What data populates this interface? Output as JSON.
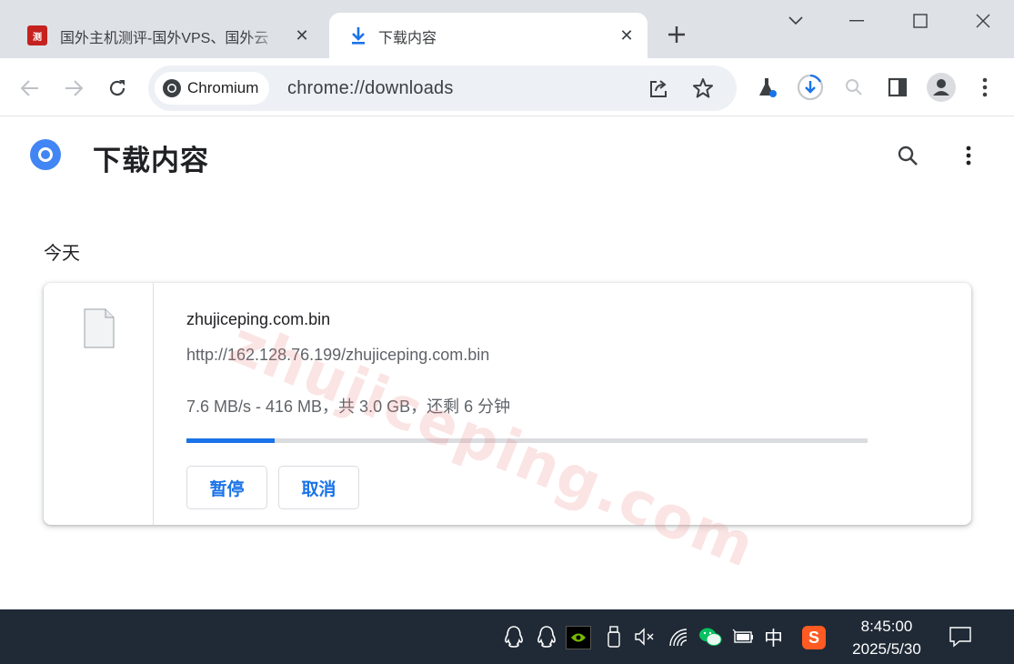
{
  "window": {
    "tabs": [
      {
        "title": "国外主机测评-国外VPS、国外云",
        "favicon": "site-logo-icon",
        "active": false
      },
      {
        "title": "下载内容",
        "favicon": "download-icon",
        "active": true
      }
    ]
  },
  "omnibox": {
    "chip_label": "Chromium",
    "url": "chrome://downloads"
  },
  "page": {
    "title": "下载内容",
    "section": "今天"
  },
  "download": {
    "filename": "zhujiceping.com.bin",
    "url": "http://162.128.76.199/zhujiceping.com.bin",
    "status": "7.6 MB/s - 416 MB，共 3.0 GB，还剩 6 分钟",
    "progress": 0.13,
    "pause_label": "暂停",
    "cancel_label": "取消"
  },
  "watermark": "zhujiceping.com",
  "taskbar": {
    "ime": "中",
    "time": "8:45:00",
    "date": "2025/5/30"
  },
  "colors": {
    "accent": "#1a73e8",
    "tabstrip": "#dee1e6",
    "taskbar": "#1f2a36"
  }
}
